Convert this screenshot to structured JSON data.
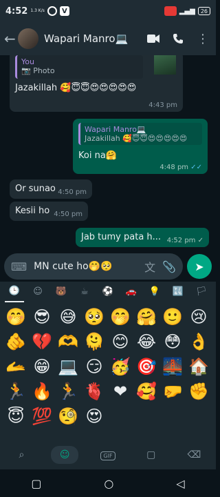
{
  "status": {
    "time": "4:52",
    "net_speed": "1.3 K/s",
    "battery": "26"
  },
  "header": {
    "back_icon": "arrow-left-icon",
    "contact_name": "Wapari Manro💻"
  },
  "messages": {
    "m1": {
      "quote_author": "You",
      "quote_text": "📷 Photo",
      "text": "Jazakillah 🥰😇😇😍😍😍😍😍",
      "time": "4:43 pm"
    },
    "m2": {
      "quote_author": "Wapari Manro💻",
      "quote_text": "Jazakillah 🥰😇😇😍😍😍😍😍",
      "text": "Koi na🤗",
      "time": "4:48 pm",
      "ticks": "✓✓"
    },
    "m3": {
      "text": "Or sunao",
      "time": "4:50 pm"
    },
    "m4": {
      "text": "Kesii ho",
      "time": "4:50 pm"
    },
    "m5": {
      "text": "Jab tumy pata h...",
      "time": "4:52 pm",
      "ticks": "✓"
    }
  },
  "composer": {
    "value": "MN cute ho🤭🥺"
  },
  "emoji_categories": [
    "🕒",
    "☺",
    "🐻",
    "☕",
    "⚽",
    "🚗",
    "💡",
    "🔣",
    "🏳"
  ],
  "emojis": [
    "🤭",
    "😎",
    "😅",
    "🥺",
    "🤭",
    "🤗",
    "🙂",
    "😢",
    "🫵",
    "💔",
    "🫶",
    "🫠",
    "😊",
    "😂",
    "😳",
    "👌",
    "🫴",
    "😁",
    "💻",
    "😏",
    "🥳",
    "🎯",
    "🌉",
    "🏠",
    "🏃",
    "🔥",
    "🏃",
    "🫀",
    "❤",
    "🥰",
    "🤛",
    "✊",
    "😇",
    "💯",
    "🧐",
    "😍"
  ],
  "keyboard_bottom": {
    "gif": "GIF"
  }
}
